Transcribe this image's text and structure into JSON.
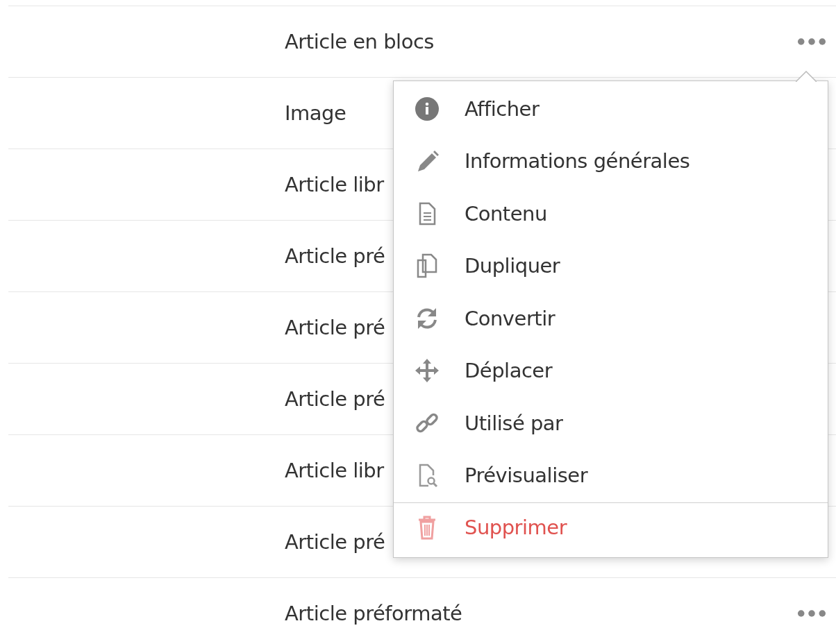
{
  "rows": [
    {
      "label": "Article en blocs",
      "menu_button": true
    },
    {
      "label": "Image",
      "menu_button": false
    },
    {
      "label": "Article libr",
      "menu_button": false
    },
    {
      "label": "Article pré",
      "menu_button": false
    },
    {
      "label": "Article pré",
      "menu_button": false
    },
    {
      "label": "Article pré",
      "menu_button": false
    },
    {
      "label": "Article libr",
      "menu_button": false
    },
    {
      "label": "Article pré",
      "menu_button": false
    },
    {
      "label": "Article préformaté",
      "menu_button": true
    }
  ],
  "menu": {
    "items": [
      {
        "label": "Afficher",
        "kind": "normal"
      },
      {
        "label": "Informations générales",
        "kind": "normal"
      },
      {
        "label": "Contenu",
        "kind": "normal"
      },
      {
        "label": "Dupliquer",
        "kind": "normal"
      },
      {
        "label": "Convertir",
        "kind": "normal"
      },
      {
        "label": "Déplacer",
        "kind": "normal"
      },
      {
        "label": "Utilisé par",
        "kind": "normal"
      },
      {
        "label": "Prévisualiser",
        "kind": "normal"
      },
      {
        "label": "Supprimer",
        "kind": "danger"
      }
    ]
  }
}
